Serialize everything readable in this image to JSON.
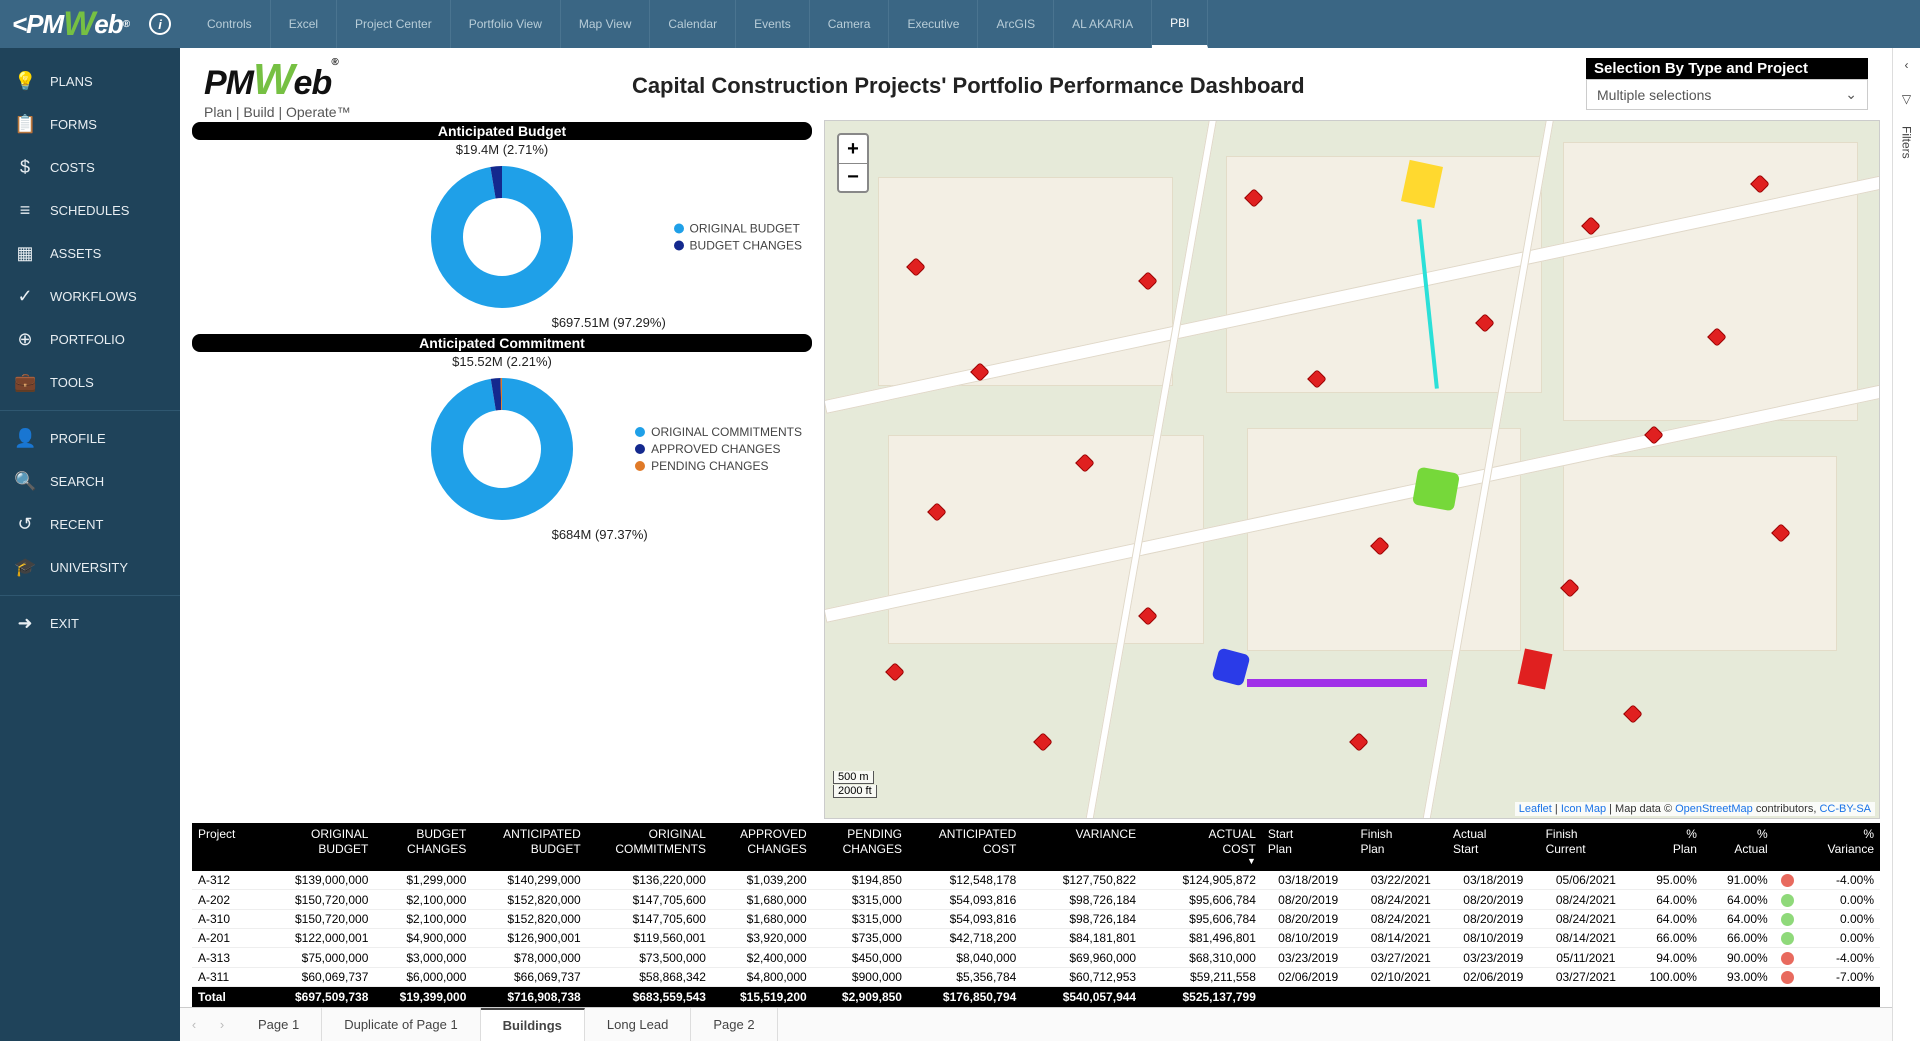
{
  "topnav": [
    "Controls",
    "Excel",
    "Project Center",
    "Portfolio View",
    "Map View",
    "Calendar",
    "Events",
    "Camera",
    "Executive",
    "ArcGIS",
    "AL AKARIA",
    "PBI"
  ],
  "topnav_active": 11,
  "sidebar": {
    "groups": [
      [
        {
          "icon": "💡",
          "label": "PLANS",
          "name": "plans"
        },
        {
          "icon": "📋",
          "label": "FORMS",
          "name": "forms"
        },
        {
          "icon": "$",
          "label": "COSTS",
          "name": "costs"
        },
        {
          "icon": "≡",
          "label": "SCHEDULES",
          "name": "schedules"
        },
        {
          "icon": "▦",
          "label": "ASSETS",
          "name": "assets"
        },
        {
          "icon": "✓",
          "label": "WORKFLOWS",
          "name": "workflows"
        },
        {
          "icon": "⊕",
          "label": "PORTFOLIO",
          "name": "portfolio"
        },
        {
          "icon": "💼",
          "label": "TOOLS",
          "name": "tools"
        }
      ],
      [
        {
          "icon": "👤",
          "label": "PROFILE",
          "name": "profile"
        },
        {
          "icon": "🔍",
          "label": "SEARCH",
          "name": "search"
        },
        {
          "icon": "↺",
          "label": "RECENT",
          "name": "recent"
        },
        {
          "icon": "🎓",
          "label": "UNIVERSITY",
          "name": "university"
        }
      ],
      [
        {
          "icon": "➜",
          "label": "EXIT",
          "name": "exit"
        }
      ]
    ]
  },
  "brand": {
    "name_1": "PM",
    "name_w": "W",
    "name_2": "eb",
    "reg": "®",
    "tag": "Plan | Build | Operate™"
  },
  "dashboard_title": "Capital Construction Projects' Portfolio Performance Dashboard",
  "selector": {
    "label": "Selection By Type and Project",
    "value": "Multiple selections"
  },
  "filters_label": "Filters",
  "chart_data": [
    {
      "type": "pie",
      "title": "Anticipated Budget",
      "series": [
        {
          "name": "ORIGINAL BUDGET",
          "value": 697.51,
          "pct": 97.29,
          "color": "#1fa0e8",
          "label": "$697.51M (97.29%)"
        },
        {
          "name": "BUDGET CHANGES",
          "value": 19.4,
          "pct": 2.71,
          "color": "#14298e",
          "label": "$19.4M (2.71%)"
        }
      ]
    },
    {
      "type": "pie",
      "title": "Anticipated Commitment",
      "series": [
        {
          "name": "ORIGINAL COMMITMENTS",
          "value": 684,
          "pct": 97.37,
          "color": "#1fa0e8",
          "label": "$684M (97.37%)"
        },
        {
          "name": "APPROVED CHANGES",
          "value": 15.52,
          "pct": 2.21,
          "color": "#14298e",
          "label": "$15.52M (2.21%)"
        },
        {
          "name": "PENDING CHANGES",
          "value": 2.95,
          "pct": 0.42,
          "color": "#e07a28",
          "label": ""
        }
      ]
    }
  ],
  "map": {
    "zoom_in": "+",
    "zoom_out": "−",
    "scale_m": "500 m",
    "scale_ft": "2000 ft",
    "attr_leaflet": "Leaflet",
    "attr_icon": "Icon Map",
    "attr_mid": " | Map data © ",
    "attr_osm": "OpenStreetMap",
    "attr_contrib": " contributors, ",
    "attr_cc": "CC-BY-SA"
  },
  "table": {
    "headers": [
      "Project",
      "ORIGINAL BUDGET",
      "BUDGET CHANGES",
      "ANTICIPATED BUDGET",
      "ORIGINAL COMMITMENTS",
      "APPROVED CHANGES",
      "PENDING CHANGES",
      "ANTICIPATED COST",
      "VARIANCE",
      "ACTUAL COST",
      "Start Plan",
      "Finish Plan",
      "Actual Start",
      "Finish Current",
      "% Plan",
      "% Actual",
      "% Variance"
    ],
    "sort_col": 9,
    "rows": [
      {
        "c": [
          "A-312",
          "$139,000,000",
          "$1,299,000",
          "$140,299,000",
          "$136,220,000",
          "$1,039,200",
          "$194,850",
          "$12,548,178",
          "$127,750,822",
          "$124,905,872",
          "03/18/2019",
          "03/22/2021",
          "03/18/2019",
          "05/06/2021",
          "95.00%",
          "91.00%",
          "-4.00%"
        ],
        "status": "red"
      },
      {
        "c": [
          "A-202",
          "$150,720,000",
          "$2,100,000",
          "$152,820,000",
          "$147,705,600",
          "$1,680,000",
          "$315,000",
          "$54,093,816",
          "$98,726,184",
          "$95,606,784",
          "08/20/2019",
          "08/24/2021",
          "08/20/2019",
          "08/24/2021",
          "64.00%",
          "64.00%",
          "0.00%"
        ],
        "status": "green"
      },
      {
        "c": [
          "A-310",
          "$150,720,000",
          "$2,100,000",
          "$152,820,000",
          "$147,705,600",
          "$1,680,000",
          "$315,000",
          "$54,093,816",
          "$98,726,184",
          "$95,606,784",
          "08/20/2019",
          "08/24/2021",
          "08/20/2019",
          "08/24/2021",
          "64.00%",
          "64.00%",
          "0.00%"
        ],
        "status": "green"
      },
      {
        "c": [
          "A-201",
          "$122,000,001",
          "$4,900,000",
          "$126,900,001",
          "$119,560,001",
          "$3,920,000",
          "$735,000",
          "$42,718,200",
          "$84,181,801",
          "$81,496,801",
          "08/10/2019",
          "08/14/2021",
          "08/10/2019",
          "08/14/2021",
          "66.00%",
          "66.00%",
          "0.00%"
        ],
        "status": "green"
      },
      {
        "c": [
          "A-313",
          "$75,000,000",
          "$3,000,000",
          "$78,000,000",
          "$73,500,000",
          "$2,400,000",
          "$450,000",
          "$8,040,000",
          "$69,960,000",
          "$68,310,000",
          "03/23/2019",
          "03/27/2021",
          "03/23/2019",
          "05/11/2021",
          "94.00%",
          "90.00%",
          "-4.00%"
        ],
        "status": "red"
      },
      {
        "c": [
          "A-311",
          "$60,069,737",
          "$6,000,000",
          "$66,069,737",
          "$58,868,342",
          "$4,800,000",
          "$900,000",
          "$5,356,784",
          "$60,712,953",
          "$59,211,558",
          "02/06/2019",
          "02/10/2021",
          "02/06/2019",
          "03/27/2021",
          "100.00%",
          "93.00%",
          "-7.00%"
        ],
        "status": "red"
      }
    ],
    "total": [
      "Total",
      "$697,509,738",
      "$19,399,000",
      "$716,908,738",
      "$683,559,543",
      "$15,519,200",
      "$2,909,850",
      "$176,850,794",
      "$540,057,944",
      "$525,137,799",
      "",
      "",
      "",
      "",
      "",
      "",
      ""
    ]
  },
  "pages": {
    "tabs": [
      "Page 1",
      "Duplicate of Page 1",
      "Buildings",
      "Long Lead",
      "Page 2"
    ],
    "active": 2
  }
}
